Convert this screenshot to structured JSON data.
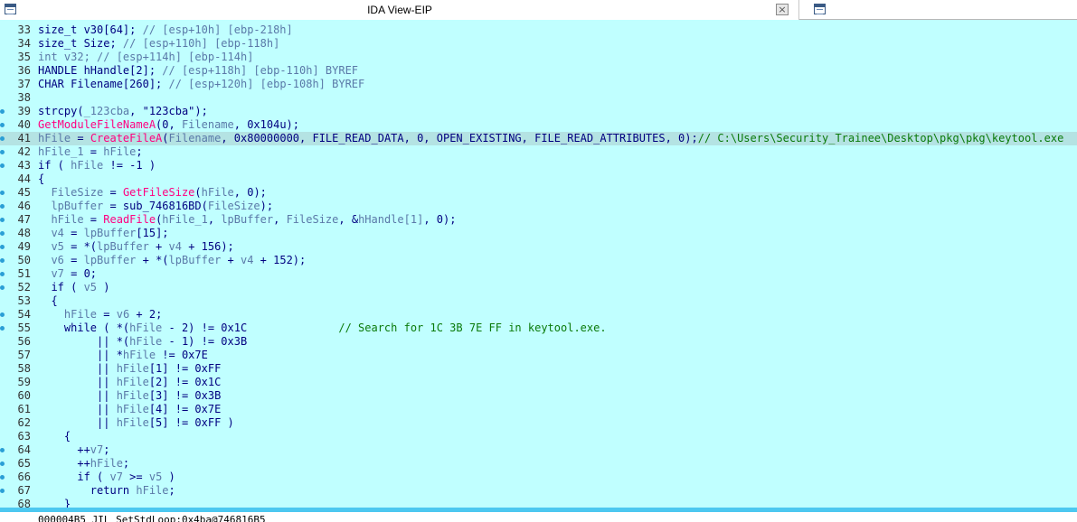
{
  "tab": {
    "title": "IDA View-EIP",
    "close_label": "×"
  },
  "lines": [
    {
      "n": "33",
      "dot": false,
      "hl": false,
      "t": [
        [
          "size_t v30[64]; ",
          "k"
        ],
        [
          "// [esp+10h] [ebp-218h]",
          "v"
        ]
      ]
    },
    {
      "n": "34",
      "dot": false,
      "hl": false,
      "t": [
        [
          "size_t Size; ",
          "k"
        ],
        [
          "// [esp+110h] [ebp-118h]",
          "v"
        ]
      ]
    },
    {
      "n": "35",
      "dot": false,
      "hl": false,
      "t": [
        [
          "int v32; ",
          "v"
        ],
        [
          "// [esp+114h] [ebp-114h]",
          "v"
        ]
      ]
    },
    {
      "n": "36",
      "dot": false,
      "hl": false,
      "t": [
        [
          "HANDLE hHandle[2]; ",
          "k"
        ],
        [
          "// [esp+118h] [ebp-110h] BYREF",
          "v"
        ]
      ]
    },
    {
      "n": "37",
      "dot": false,
      "hl": false,
      "t": [
        [
          "CHAR Filename[260]; ",
          "k"
        ],
        [
          "// [esp+120h] [ebp-108h] BYREF",
          "v"
        ]
      ]
    },
    {
      "n": "38",
      "dot": false,
      "hl": false,
      "t": []
    },
    {
      "n": "39",
      "dot": true,
      "hl": false,
      "t": [
        [
          "strcpy(",
          "k"
        ],
        [
          "_123cba",
          "v"
        ],
        [
          ", \"123cba\");",
          "k"
        ]
      ]
    },
    {
      "n": "40",
      "dot": true,
      "hl": false,
      "t": [
        [
          "GetModuleFileNameA",
          "f"
        ],
        [
          "(0, ",
          "k"
        ],
        [
          "Filename",
          "v"
        ],
        [
          ", 0x104u);",
          "k"
        ]
      ]
    },
    {
      "n": "41",
      "dot": true,
      "hl": true,
      "t": [
        [
          "hFile",
          "v"
        ],
        [
          " = ",
          "k"
        ],
        [
          "CreateFileA",
          "f"
        ],
        [
          "(",
          "k"
        ],
        [
          "Filename",
          "v"
        ],
        [
          ", 0x80000000, FILE_READ_DATA, 0, OPEN_EXISTING, FILE_READ_ATTRIBUTES, 0);",
          "k"
        ],
        [
          "// C:\\Users\\Security_Trainee\\Desktop\\pkg\\pkg\\keytool.exe",
          "c"
        ]
      ]
    },
    {
      "n": "42",
      "dot": true,
      "hl": false,
      "t": [
        [
          "hFile_1",
          "v"
        ],
        [
          " = ",
          "k"
        ],
        [
          "hFile",
          "v"
        ],
        [
          ";",
          "k"
        ]
      ]
    },
    {
      "n": "43",
      "dot": true,
      "hl": false,
      "t": [
        [
          "if ( ",
          "k"
        ],
        [
          "hFile",
          "v"
        ],
        [
          " != -1 )",
          "k"
        ]
      ]
    },
    {
      "n": "44",
      "dot": false,
      "hl": false,
      "t": [
        [
          "{",
          "k"
        ]
      ]
    },
    {
      "n": "45",
      "dot": true,
      "hl": false,
      "t": [
        [
          "  FileSize",
          "v"
        ],
        [
          " = ",
          "k"
        ],
        [
          "GetFileSize",
          "f"
        ],
        [
          "(",
          "k"
        ],
        [
          "hFile",
          "v"
        ],
        [
          ", 0);",
          "k"
        ]
      ]
    },
    {
      "n": "46",
      "dot": true,
      "hl": false,
      "t": [
        [
          "  lpBuffer",
          "v"
        ],
        [
          " = sub_746816BD(",
          "k"
        ],
        [
          "FileSize",
          "v"
        ],
        [
          ");",
          "k"
        ]
      ]
    },
    {
      "n": "47",
      "dot": true,
      "hl": false,
      "t": [
        [
          "  hFile",
          "v"
        ],
        [
          " = ",
          "k"
        ],
        [
          "ReadFile",
          "f"
        ],
        [
          "(",
          "k"
        ],
        [
          "hFile_1",
          "v"
        ],
        [
          ", ",
          "k"
        ],
        [
          "lpBuffer",
          "v"
        ],
        [
          ", ",
          "k"
        ],
        [
          "FileSize",
          "v"
        ],
        [
          ", &",
          "k"
        ],
        [
          "hHandle[1]",
          "v"
        ],
        [
          ", 0);",
          "k"
        ]
      ]
    },
    {
      "n": "48",
      "dot": true,
      "hl": false,
      "t": [
        [
          "  v4",
          "v"
        ],
        [
          " = ",
          "k"
        ],
        [
          "lpBuffer",
          "v"
        ],
        [
          "[15];",
          "k"
        ]
      ]
    },
    {
      "n": "49",
      "dot": true,
      "hl": false,
      "t": [
        [
          "  v5",
          "v"
        ],
        [
          " = *(",
          "k"
        ],
        [
          "lpBuffer",
          "v"
        ],
        [
          " + ",
          "k"
        ],
        [
          "v4",
          "v"
        ],
        [
          " + 156);",
          "k"
        ]
      ]
    },
    {
      "n": "50",
      "dot": true,
      "hl": false,
      "t": [
        [
          "  v6",
          "v"
        ],
        [
          " = ",
          "k"
        ],
        [
          "lpBuffer",
          "v"
        ],
        [
          " + *(",
          "k"
        ],
        [
          "lpBuffer",
          "v"
        ],
        [
          " + ",
          "k"
        ],
        [
          "v4",
          "v"
        ],
        [
          " + 152);",
          "k"
        ]
      ]
    },
    {
      "n": "51",
      "dot": true,
      "hl": false,
      "t": [
        [
          "  v7",
          "v"
        ],
        [
          " = 0;",
          "k"
        ]
      ]
    },
    {
      "n": "52",
      "dot": true,
      "hl": false,
      "t": [
        [
          "  if ( ",
          "k"
        ],
        [
          "v5",
          "v"
        ],
        [
          " )",
          "k"
        ]
      ]
    },
    {
      "n": "53",
      "dot": false,
      "hl": false,
      "t": [
        [
          "  {",
          "k"
        ]
      ]
    },
    {
      "n": "54",
      "dot": true,
      "hl": false,
      "t": [
        [
          "    hFile",
          "v"
        ],
        [
          " = ",
          "k"
        ],
        [
          "v6",
          "v"
        ],
        [
          " + 2;",
          "k"
        ]
      ]
    },
    {
      "n": "55",
      "dot": true,
      "hl": false,
      "t": [
        [
          "    while ( *(",
          "k"
        ],
        [
          "hFile",
          "v"
        ],
        [
          " - 2) != 0x1C              ",
          "k"
        ],
        [
          "// Search for 1C 3B 7E FF in keytool.exe.",
          "c"
        ]
      ]
    },
    {
      "n": "56",
      "dot": false,
      "hl": false,
      "t": [
        [
          "         || *(",
          "k"
        ],
        [
          "hFile",
          "v"
        ],
        [
          " - 1) != 0x3B",
          "k"
        ]
      ]
    },
    {
      "n": "57",
      "dot": false,
      "hl": false,
      "t": [
        [
          "         || *",
          "k"
        ],
        [
          "hFile",
          "v"
        ],
        [
          " != 0x7E",
          "k"
        ]
      ]
    },
    {
      "n": "58",
      "dot": false,
      "hl": false,
      "t": [
        [
          "         || ",
          "k"
        ],
        [
          "hFile",
          "v"
        ],
        [
          "[1] != 0xFF",
          "k"
        ]
      ]
    },
    {
      "n": "59",
      "dot": false,
      "hl": false,
      "t": [
        [
          "         || ",
          "k"
        ],
        [
          "hFile",
          "v"
        ],
        [
          "[2] != 0x1C",
          "k"
        ]
      ]
    },
    {
      "n": "60",
      "dot": false,
      "hl": false,
      "t": [
        [
          "         || ",
          "k"
        ],
        [
          "hFile",
          "v"
        ],
        [
          "[3] != 0x3B",
          "k"
        ]
      ]
    },
    {
      "n": "61",
      "dot": false,
      "hl": false,
      "t": [
        [
          "         || ",
          "k"
        ],
        [
          "hFile",
          "v"
        ],
        [
          "[4] != 0x7E",
          "k"
        ]
      ]
    },
    {
      "n": "62",
      "dot": false,
      "hl": false,
      "t": [
        [
          "         || ",
          "k"
        ],
        [
          "hFile",
          "v"
        ],
        [
          "[5] != 0xFF )",
          "k"
        ]
      ]
    },
    {
      "n": "63",
      "dot": false,
      "hl": false,
      "t": [
        [
          "    {",
          "k"
        ]
      ]
    },
    {
      "n": "64",
      "dot": true,
      "hl": false,
      "t": [
        [
          "      ++",
          "k"
        ],
        [
          "v7",
          "v"
        ],
        [
          ";",
          "k"
        ]
      ]
    },
    {
      "n": "65",
      "dot": true,
      "hl": false,
      "t": [
        [
          "      ++",
          "k"
        ],
        [
          "hFile",
          "v"
        ],
        [
          ";",
          "k"
        ]
      ]
    },
    {
      "n": "66",
      "dot": true,
      "hl": false,
      "t": [
        [
          "      if ( ",
          "k"
        ],
        [
          "v7",
          "v"
        ],
        [
          " >= ",
          "k"
        ],
        [
          "v5",
          "v"
        ],
        [
          " )",
          "k"
        ]
      ]
    },
    {
      "n": "67",
      "dot": true,
      "hl": false,
      "t": [
        [
          "        return ",
          "k"
        ],
        [
          "hFile",
          "v"
        ],
        [
          ";",
          "k"
        ]
      ]
    },
    {
      "n": "68",
      "dot": false,
      "hl": false,
      "t": [
        [
          "    }",
          "k"
        ]
      ]
    }
  ],
  "status_text": "000004B5 JIL_SetStdLoop:0x4ba@746816B5"
}
